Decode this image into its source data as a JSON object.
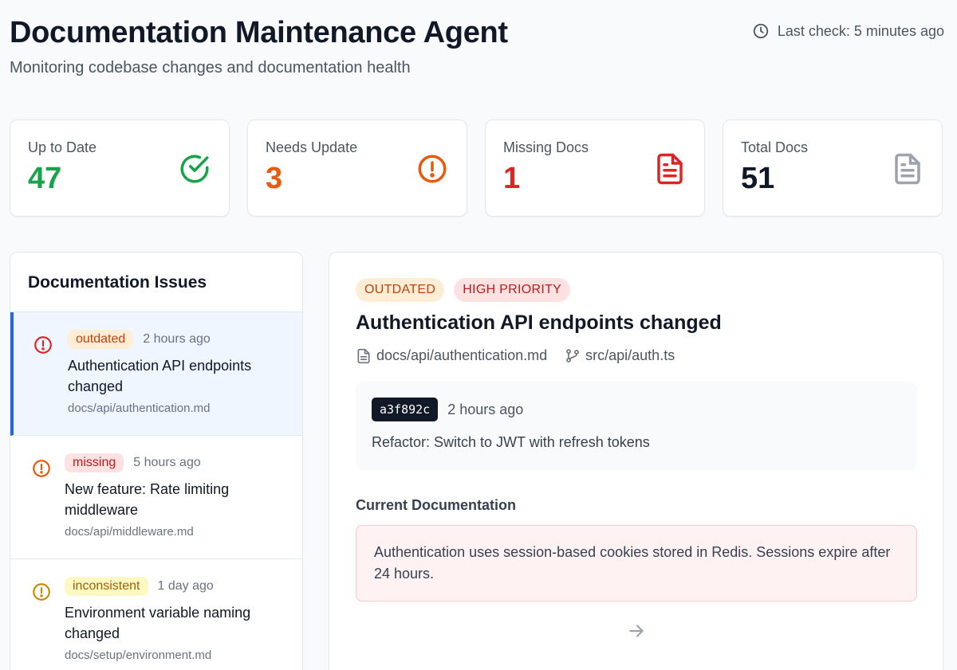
{
  "header": {
    "title": "Documentation Maintenance Agent",
    "subtitle": "Monitoring codebase changes and documentation health",
    "last_check": "Last check: 5 minutes ago"
  },
  "stats": [
    {
      "label": "Up to Date",
      "value": "47",
      "color": "#16a34a",
      "icon": "check-circle-icon"
    },
    {
      "label": "Needs Update",
      "value": "3",
      "color": "#ea580c",
      "icon": "alert-circle-icon"
    },
    {
      "label": "Missing Docs",
      "value": "1",
      "color": "#dc2626",
      "icon": "document-icon"
    },
    {
      "label": "Total Docs",
      "value": "51",
      "color": "#111827",
      "icon": "document-icon"
    }
  ],
  "issues": {
    "title": "Documentation Issues",
    "items": [
      {
        "badge": "outdated",
        "time": "2 hours ago",
        "title": "Authentication API endpoints changed",
        "path": "docs/api/authentication.md",
        "icon_color": "#dc2626"
      },
      {
        "badge": "missing",
        "time": "5 hours ago",
        "title": "New feature: Rate limiting middleware",
        "path": "docs/api/middleware.md",
        "icon_color": "#ea580c"
      },
      {
        "badge": "inconsistent",
        "time": "1 day ago",
        "title": "Environment variable naming changed",
        "path": "docs/setup/environment.md",
        "icon_color": "#ca8a04"
      }
    ]
  },
  "detail": {
    "tag_status": "OUTDATED",
    "tag_priority": "HIGH PRIORITY",
    "title": "Authentication API endpoints changed",
    "doc_file": "docs/api/authentication.md",
    "src_file": "src/api/auth.ts",
    "commit": {
      "hash": "a3f892c",
      "time": "2 hours ago",
      "message": "Refactor: Switch to JWT with refresh tokens"
    },
    "current_doc_label": "Current Documentation",
    "current_doc_text": "Authentication uses session-based cookies stored in Redis. Sessions expire after 24 hours."
  }
}
